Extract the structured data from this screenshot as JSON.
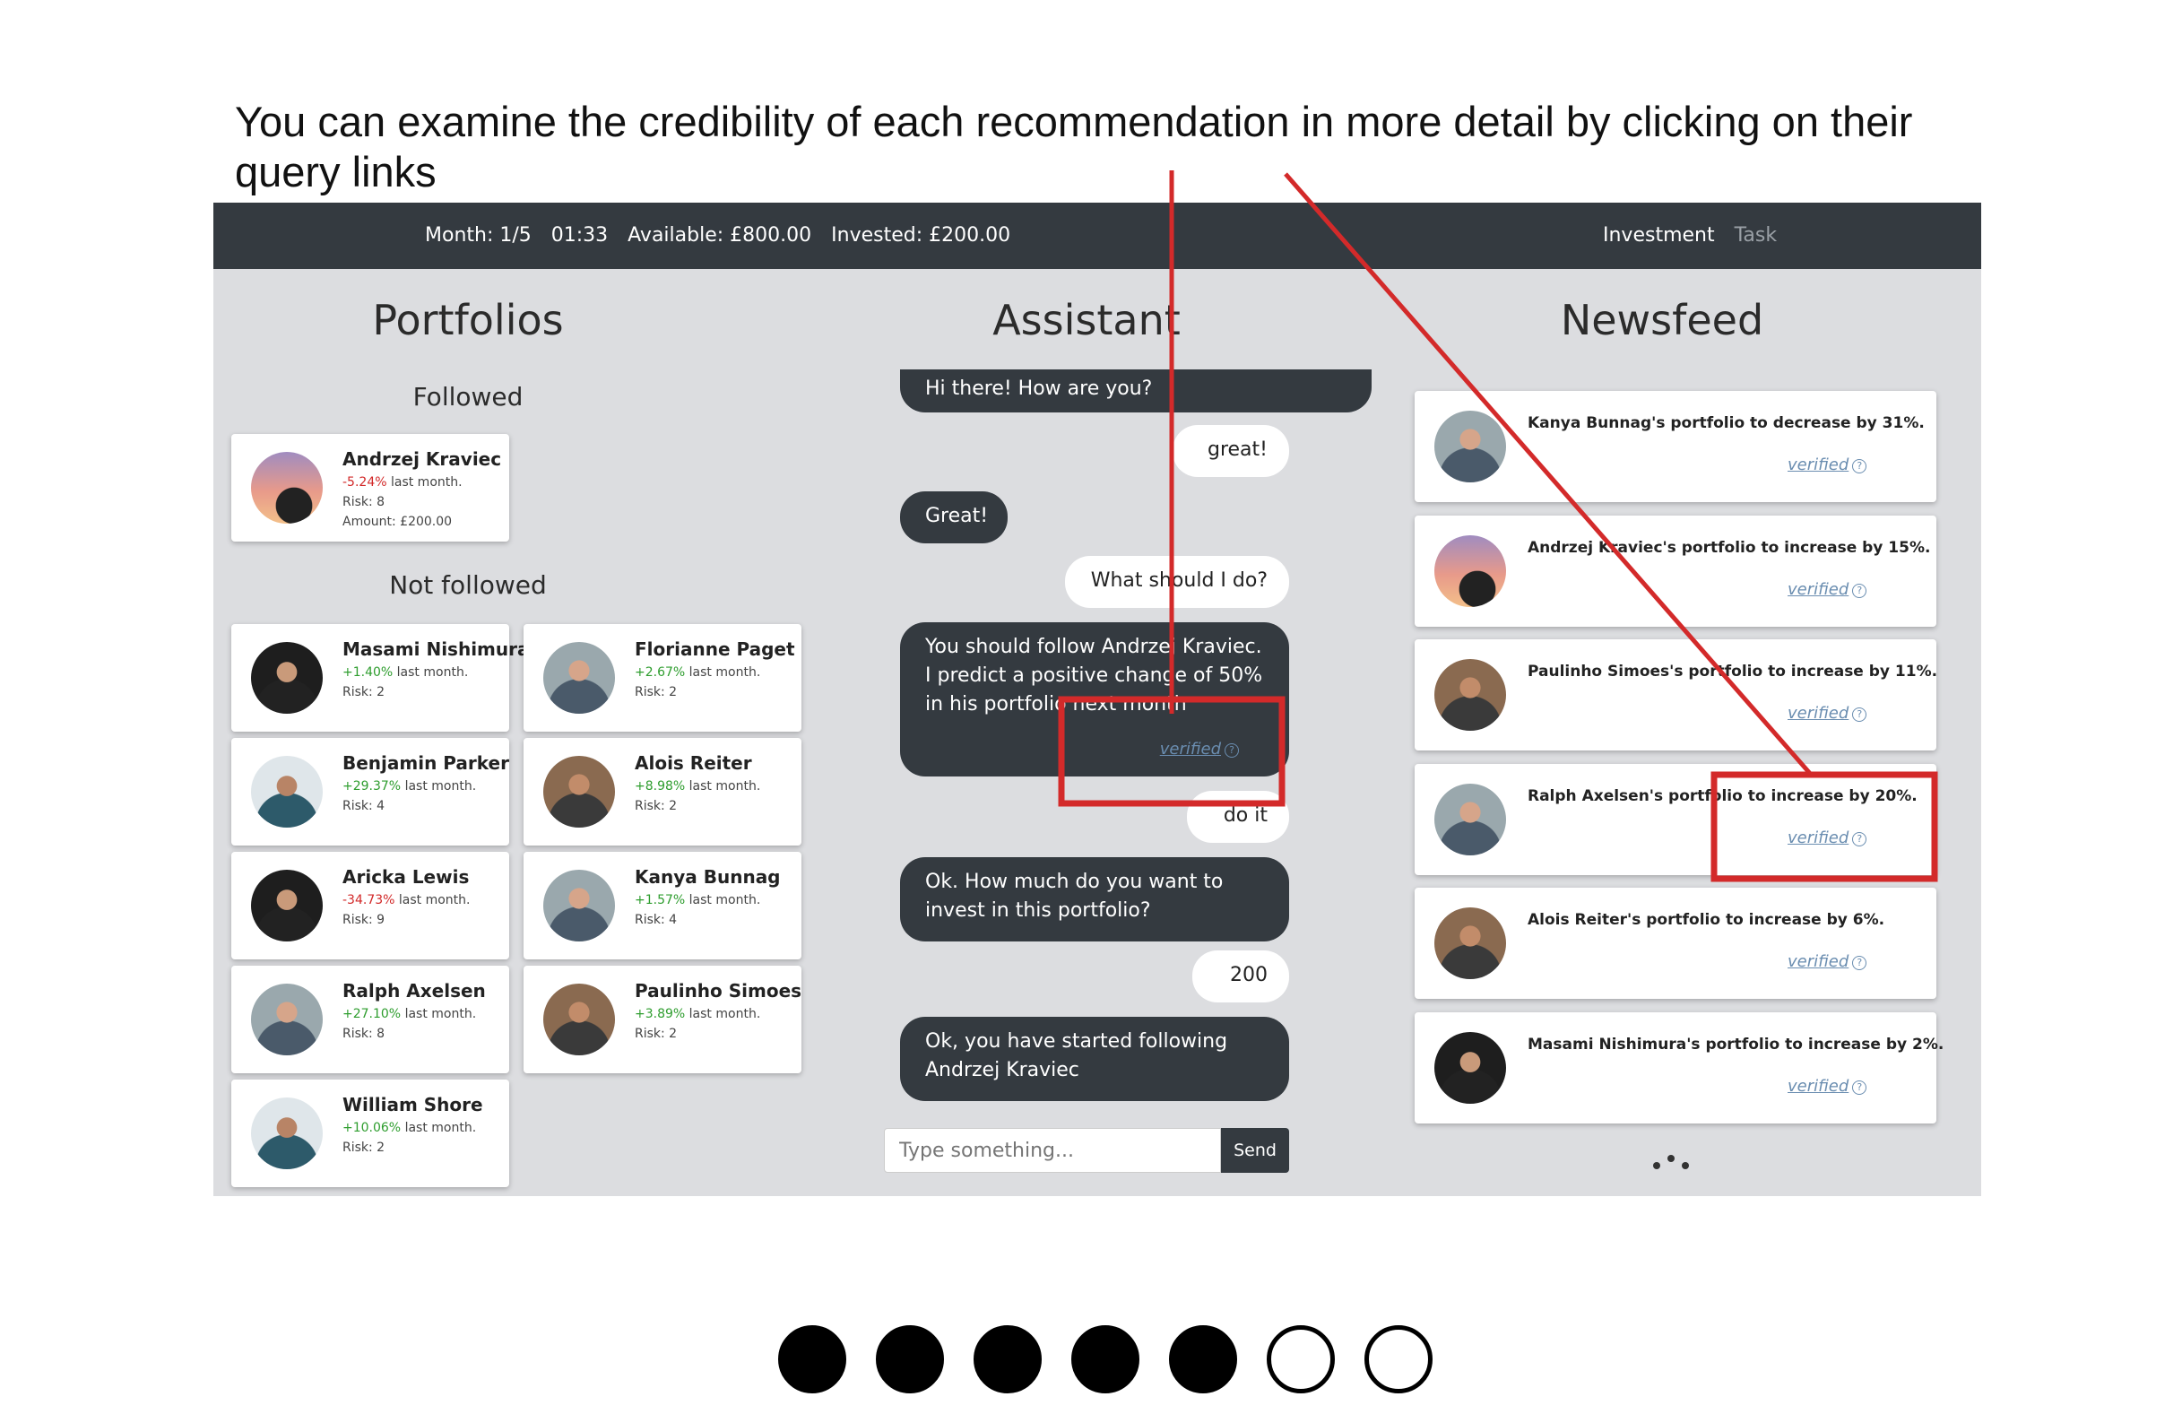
{
  "caption": "You can examine the credibility of each recommendation in more detail by clicking on their query links",
  "topbar": {
    "month": "Month: 1/5",
    "timer": "01:33",
    "available": "Available: £800.00",
    "invested": "Invested: £200.00",
    "nav_investment": "Investment",
    "nav_task": "Task"
  },
  "portfolios": {
    "title": "Portfolios",
    "followed_title": "Followed",
    "not_followed_title": "Not followed",
    "suffix": "last month.",
    "followed": [
      {
        "name": "Andrzej Kraviec",
        "change": "-5.24%",
        "risk": "Risk: 8",
        "amount": "Amount: £200.00",
        "avatar": "sunset-silhouette"
      }
    ],
    "not_followed": [
      {
        "name": "Masami Nishimura",
        "change": "+1.40%",
        "risk": "Risk: 2",
        "avatar": "dark-portrait"
      },
      {
        "name": "Florianne Paget",
        "change": "+2.67%",
        "risk": "Risk: 2",
        "avatar": "light-portrait"
      },
      {
        "name": "Benjamin Parker",
        "change": "+29.37%",
        "risk": "Risk: 4",
        "avatar": "blue-portrait"
      },
      {
        "name": "Alois Reiter",
        "change": "+8.98%",
        "risk": "Risk: 2",
        "avatar": "warm-portrait"
      },
      {
        "name": "Aricka Lewis",
        "change": "-34.73%",
        "risk": "Risk: 9",
        "avatar": "dark-portrait"
      },
      {
        "name": "Kanya Bunnag",
        "change": "+1.57%",
        "risk": "Risk: 4",
        "avatar": "light-portrait"
      },
      {
        "name": "Ralph Axelsen",
        "change": "+27.10%",
        "risk": "Risk: 8",
        "avatar": "light-portrait"
      },
      {
        "name": "Paulinho Simoes",
        "change": "+3.89%",
        "risk": "Risk: 2",
        "avatar": "warm-portrait"
      },
      {
        "name": "William Shore",
        "change": "+10.06%",
        "risk": "Risk: 2",
        "avatar": "blue-portrait"
      }
    ]
  },
  "assistant": {
    "title": "Assistant",
    "messages": [
      {
        "from": "bot",
        "text": "Hi there! How are you?"
      },
      {
        "from": "user",
        "text": "great!"
      },
      {
        "from": "bot",
        "text": "Great!"
      },
      {
        "from": "user",
        "text": "What should I do?"
      },
      {
        "from": "bot",
        "text": "You should follow Andrzej Kraviec. I predict a positive change of 50% in his portfolio next month",
        "link": "verified"
      },
      {
        "from": "user",
        "text": "do it"
      },
      {
        "from": "bot",
        "text": "Ok. How much do you want to invest in this portfolio?"
      },
      {
        "from": "user",
        "text": "200"
      },
      {
        "from": "bot",
        "text": "Ok, you have started following Andrzej Kraviec"
      }
    ],
    "input_placeholder": "Type something...",
    "send_label": "Send"
  },
  "newsfeed": {
    "title": "Newsfeed",
    "link_label": "verified",
    "items": [
      {
        "text": "Kanya Bunnag's portfolio to decrease by 31%.",
        "avatar": "light-portrait"
      },
      {
        "text": "Andrzej Kraviec's portfolio to increase by 15%.",
        "avatar": "sunset-silhouette"
      },
      {
        "text": "Paulinho Simoes's portfolio to increase by 11%.",
        "avatar": "warm-portrait"
      },
      {
        "text": "Ralph Axelsen's portfolio to increase by 20%.",
        "avatar": "light-portrait"
      },
      {
        "text": "Alois Reiter's portfolio to increase by 6%.",
        "avatar": "warm-portrait"
      },
      {
        "text": "Masami Nishimura's portfolio to increase by 2%.",
        "avatar": "dark-portrait"
      }
    ]
  },
  "colors": {
    "topbar": "#343a40",
    "panel": "#dcdde0",
    "positive": "#2e9d2e",
    "negative": "#d22828",
    "annotation": "#d32a2a",
    "link": "#6a8db0"
  },
  "progress": {
    "total": 7,
    "filled": 5
  }
}
